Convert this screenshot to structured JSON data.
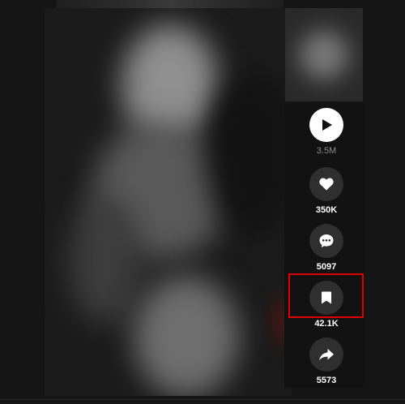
{
  "actions": {
    "play": {
      "icon": "play-icon",
      "count": "3.5M"
    },
    "like": {
      "icon": "heart-icon",
      "count": "350K"
    },
    "comment": {
      "icon": "comment-icon",
      "count": "5097"
    },
    "bookmark": {
      "icon": "bookmark-icon",
      "count": "42.1K"
    },
    "share": {
      "icon": "share-icon",
      "count": "5573"
    }
  },
  "colors": {
    "background": "#151515",
    "icon_circle": "#2f2f2f",
    "play_circle": "#ffffff",
    "highlight": "#e00000",
    "views_text": "#8a8a8a"
  }
}
